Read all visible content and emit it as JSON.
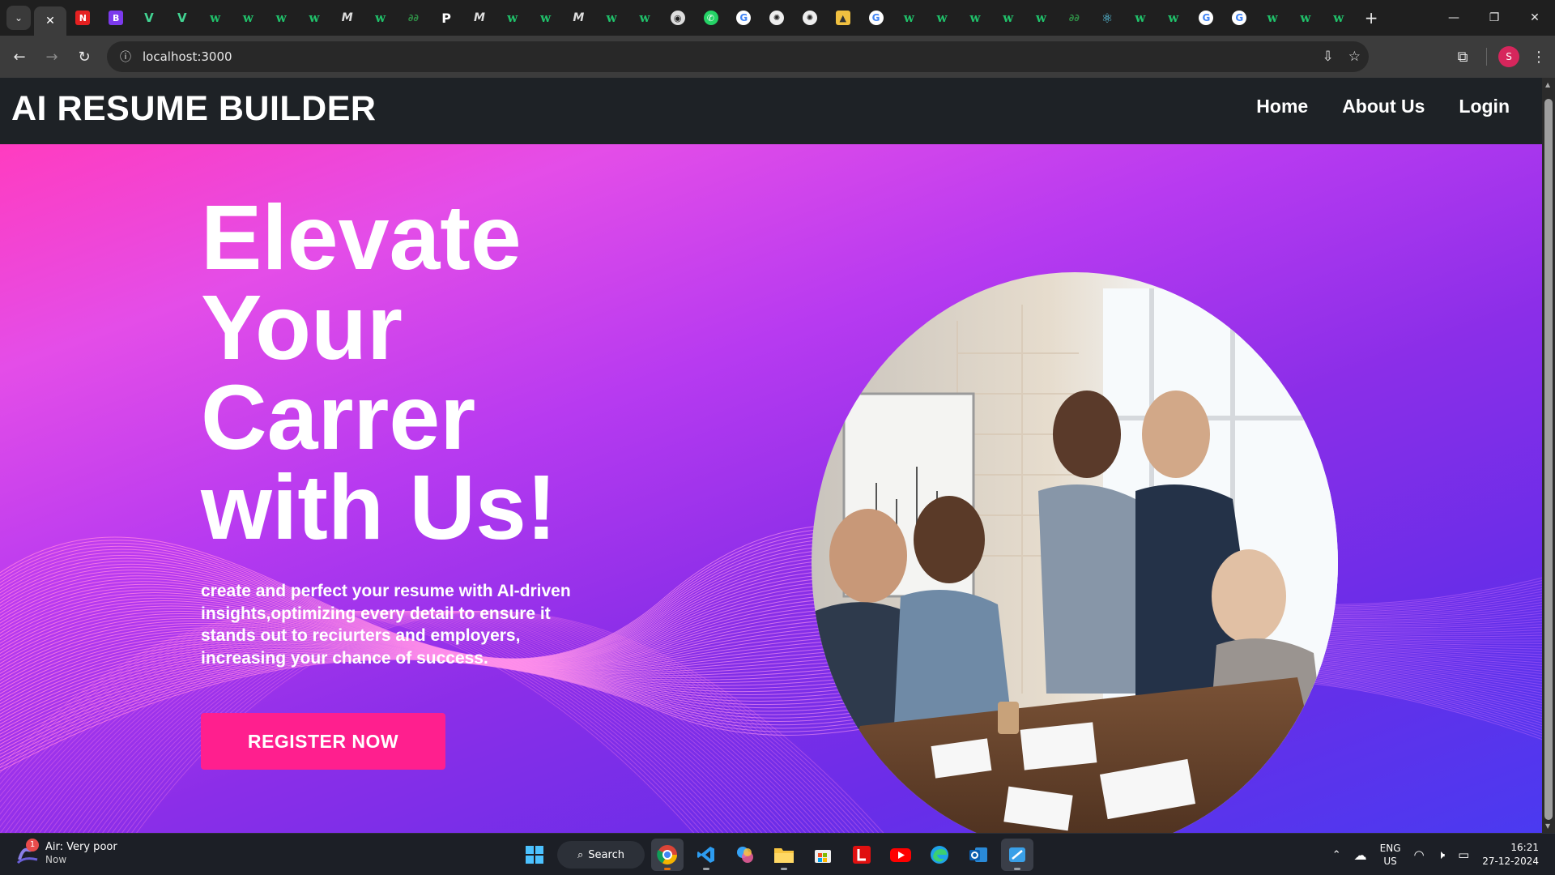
{
  "browser": {
    "url": "localhost:3000",
    "tabs": [
      {
        "icon": "netflix-icon",
        "glyph": "N",
        "cls": "nr"
      },
      {
        "icon": "bootstrap-icon",
        "glyph": "B",
        "cls": "bs"
      },
      {
        "icon": "vue-icon",
        "glyph": "V",
        "cls": "v"
      },
      {
        "icon": "vue-icon",
        "glyph": "V",
        "cls": "v"
      },
      {
        "icon": "w3schools-icon",
        "glyph": "w",
        "cls": "w"
      },
      {
        "icon": "w3schools-icon",
        "glyph": "w",
        "cls": "w"
      },
      {
        "icon": "w3schools-icon",
        "glyph": "w",
        "cls": "w"
      },
      {
        "icon": "w3schools-icon",
        "glyph": "w",
        "cls": "w"
      },
      {
        "icon": "medium-icon",
        "glyph": "M",
        "cls": "m"
      },
      {
        "icon": "w3schools-icon",
        "glyph": "w",
        "cls": "w"
      },
      {
        "icon": "geeksforgeeks-icon",
        "glyph": "∂∂",
        "cls": "gfg"
      },
      {
        "icon": "p-icon",
        "glyph": "P",
        "cls": "p"
      },
      {
        "icon": "medium-icon",
        "glyph": "M",
        "cls": "m"
      },
      {
        "icon": "w3schools-icon",
        "glyph": "w",
        "cls": "w"
      },
      {
        "icon": "w3schools-icon",
        "glyph": "w",
        "cls": "w"
      },
      {
        "icon": "medium-icon",
        "glyph": "M",
        "cls": "m"
      },
      {
        "icon": "w3schools-icon",
        "glyph": "w",
        "cls": "w"
      },
      {
        "icon": "w3schools-icon",
        "glyph": "w",
        "cls": "w"
      },
      {
        "icon": "github-icon",
        "glyph": "◉",
        "cls": "gh"
      },
      {
        "icon": "whatsapp-icon",
        "glyph": "✆",
        "cls": "wa"
      },
      {
        "icon": "google-icon",
        "glyph": "G",
        "cls": "g"
      },
      {
        "icon": "chatgpt-icon",
        "glyph": "✺",
        "cls": "gpt"
      },
      {
        "icon": "chatgpt-icon",
        "glyph": "✺",
        "cls": "gpt"
      },
      {
        "icon": "photo-icon",
        "glyph": "▲",
        "cls": "ph"
      },
      {
        "icon": "google-icon",
        "glyph": "G",
        "cls": "g"
      },
      {
        "icon": "w3schools-icon",
        "glyph": "w",
        "cls": "w"
      },
      {
        "icon": "w3schools-icon",
        "glyph": "w",
        "cls": "w"
      },
      {
        "icon": "w3schools-icon",
        "glyph": "w",
        "cls": "w"
      },
      {
        "icon": "w3schools-icon",
        "glyph": "w",
        "cls": "w"
      },
      {
        "icon": "w3schools-icon",
        "glyph": "w",
        "cls": "w"
      },
      {
        "icon": "geeksforgeeks-icon",
        "glyph": "∂∂",
        "cls": "gfg"
      },
      {
        "icon": "react-icon",
        "glyph": "⚛",
        "cls": "re"
      },
      {
        "icon": "w3schools-icon",
        "glyph": "w",
        "cls": "w"
      },
      {
        "icon": "w3schools-icon",
        "glyph": "w",
        "cls": "w"
      },
      {
        "icon": "google-icon",
        "glyph": "G",
        "cls": "g"
      },
      {
        "icon": "google-icon",
        "glyph": "G",
        "cls": "g"
      },
      {
        "icon": "w3schools-icon",
        "glyph": "w",
        "cls": "w"
      },
      {
        "icon": "w3schools-icon",
        "glyph": "w",
        "cls": "w"
      },
      {
        "icon": "w3schools-icon",
        "glyph": "w",
        "cls": "w"
      }
    ],
    "profile_initial": "S"
  },
  "site": {
    "brand": "AI RESUME BUILDER",
    "nav": {
      "home": "Home",
      "about": "About Us",
      "login": "Login"
    }
  },
  "hero": {
    "title_lines": [
      "Elevate",
      "Your",
      "Carrer",
      "with Us!"
    ],
    "description": "create and perfect your resume with AI-driven insights,optimizing every detail to ensure it stands out to reciurters and employers, increasing your chance of success.",
    "cta": "REGISTER NOW",
    "photo_icon": "team-meeting-photo"
  },
  "taskbar": {
    "weather_badge": "1",
    "weather_title": "Air: Very poor",
    "weather_sub": "Now",
    "search": "Search",
    "lang_top": "ENG",
    "lang_bottom": "US",
    "time": "16:21",
    "date": "27-12-2024"
  },
  "colors": {
    "cta": "#ff1f8e",
    "nav_bg": "#1e2226",
    "hero_start": "#ff3cc0",
    "hero_end": "#4a3af0"
  }
}
